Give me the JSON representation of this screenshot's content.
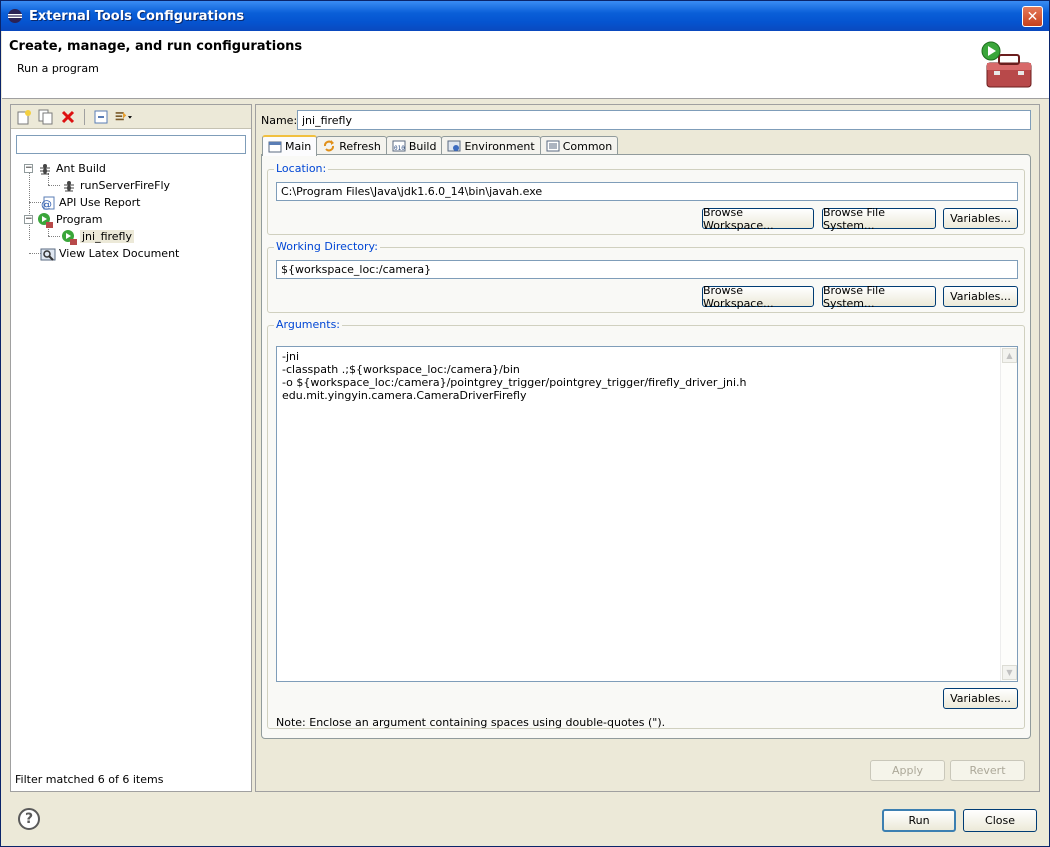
{
  "window": {
    "title": "External Tools Configurations",
    "close_glyph": "✕"
  },
  "banner": {
    "title": "Create, manage, and run configurations",
    "subtitle": "Run a program",
    "icon": "toolbox-run-icon"
  },
  "left": {
    "toolbar": [
      "new-config-icon",
      "duplicate-icon",
      "delete-icon",
      "collapse-all-icon",
      "filter-icon"
    ],
    "filter_value": "",
    "tree": [
      {
        "label": "Ant Build",
        "icon": "ant-icon",
        "level": 0,
        "expanded": true
      },
      {
        "label": "runServerFireFly",
        "icon": "ant-icon",
        "level": 1
      },
      {
        "label": "API Use Report",
        "icon": "api-report-icon",
        "level": 0
      },
      {
        "label": "Program",
        "icon": "program-icon",
        "level": 0,
        "expanded": true
      },
      {
        "label": "jni_firefly",
        "icon": "program-icon",
        "level": 1,
        "selected": true
      },
      {
        "label": "View Latex Document",
        "icon": "latex-view-icon",
        "level": 0
      }
    ],
    "status": "Filter matched 6 of 6 items",
    "expander_minus": "−"
  },
  "right": {
    "name_label": "Name:",
    "name_value": "jni_firefly",
    "tabs": [
      {
        "label": "Main",
        "icon": "main-tab-icon",
        "active": true
      },
      {
        "label": "Refresh",
        "icon": "refresh-icon"
      },
      {
        "label": "Build",
        "icon": "build-icon"
      },
      {
        "label": "Environment",
        "icon": "environment-icon"
      },
      {
        "label": "Common",
        "icon": "common-icon"
      }
    ],
    "location": {
      "legend": "Location:",
      "value": "C:\\Program Files\\Java\\jdk1.6.0_14\\bin\\javah.exe",
      "browse_workspace": "Browse Workspace...",
      "browse_fs": "Browse File System...",
      "variables": "Variables..."
    },
    "working_dir": {
      "legend": "Working Directory:",
      "value": "${workspace_loc:/camera}",
      "browse_workspace": "Browse Workspace...",
      "browse_fs": "Browse File System...",
      "variables": "Variables..."
    },
    "arguments": {
      "legend": "Arguments:",
      "text": "-jni\n-classpath .;${workspace_loc:/camera}/bin\n-o ${workspace_loc:/camera}/pointgrey_trigger/pointgrey_trigger/firefly_driver_jni.h\nedu.mit.yingyin.camera.CameraDriverFirefly",
      "variables": "Variables...",
      "note": "Note: Enclose an argument containing spaces using double-quotes (\")."
    },
    "apply": "Apply",
    "revert": "Revert"
  },
  "footer": {
    "help": "?",
    "run": "Run",
    "close": "Close"
  }
}
